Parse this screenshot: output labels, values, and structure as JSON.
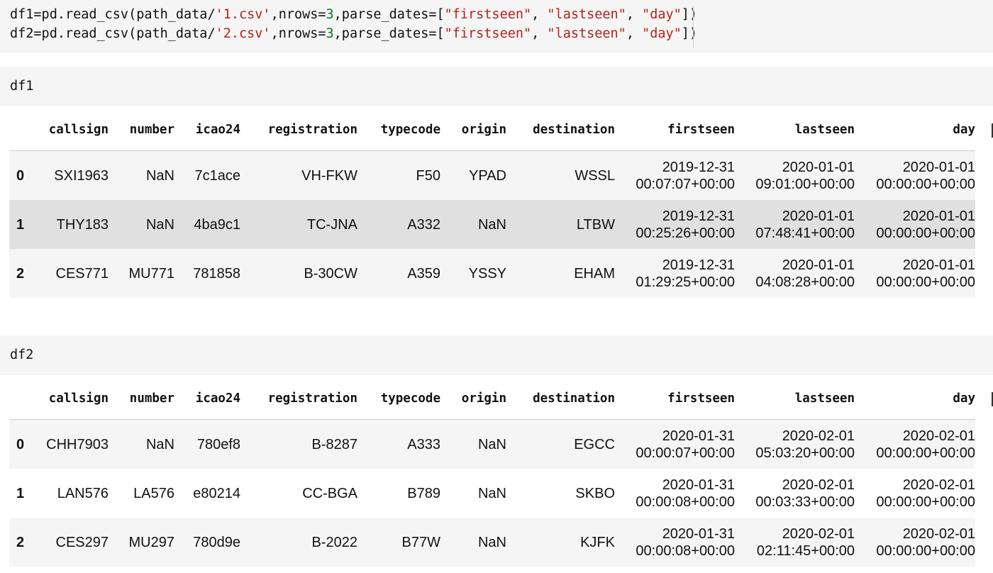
{
  "code": {
    "line1": {
      "a": "df1=pd.read_csv(path_data/",
      "b": "'1.csv'",
      "c": ",nrows=",
      "d": "3",
      "e": ",parse_dates=[",
      "f": "\"firstseen\"",
      "g": ", ",
      "h": "\"lastseen\"",
      "i": ", ",
      "j": "\"day\"",
      "k": "])"
    },
    "line2": {
      "a": "df2=pd.read_csv(path_data/",
      "b": "'2.csv'",
      "c": ",nrows=",
      "d": "3",
      "e": ",parse_dates=[",
      "f": "\"firstseen\"",
      "g": ", ",
      "h": "\"lastseen\"",
      "i": ", ",
      "j": "\"day\"",
      "k": "])"
    }
  },
  "cells": {
    "df1_input": "df1",
    "df2_input": "df2"
  },
  "columns": [
    "",
    "callsign",
    "number",
    "icao24",
    "registration",
    "typecode",
    "origin",
    "destination",
    "firstseen",
    "lastseen",
    "day"
  ],
  "df1": {
    "rows": [
      {
        "idx": "0",
        "callsign": "SXI1963",
        "number": "NaN",
        "icao24": "7c1ace",
        "registration": "VH-FKW",
        "typecode": "F50",
        "origin": "YPAD",
        "destination": "WSSL",
        "firstseen_date": "2019-12-31",
        "firstseen_time": "00:07:07+00:00",
        "lastseen_date": "2020-01-01",
        "lastseen_time": "09:01:00+00:00",
        "day_date": "2020-01-01",
        "day_time": "00:00:00+00:00"
      },
      {
        "idx": "1",
        "callsign": "THY183",
        "number": "NaN",
        "icao24": "4ba9c1",
        "registration": "TC-JNA",
        "typecode": "A332",
        "origin": "NaN",
        "destination": "LTBW",
        "firstseen_date": "2019-12-31",
        "firstseen_time": "00:25:26+00:00",
        "lastseen_date": "2020-01-01",
        "lastseen_time": "07:48:41+00:00",
        "day_date": "2020-01-01",
        "day_time": "00:00:00+00:00"
      },
      {
        "idx": "2",
        "callsign": "CES771",
        "number": "MU771",
        "icao24": "781858",
        "registration": "B-30CW",
        "typecode": "A359",
        "origin": "YSSY",
        "destination": "EHAM",
        "firstseen_date": "2019-12-31",
        "firstseen_time": "01:29:25+00:00",
        "lastseen_date": "2020-01-01",
        "lastseen_time": "04:08:28+00:00",
        "day_date": "2020-01-01",
        "day_time": "00:00:00+00:00"
      }
    ]
  },
  "df2": {
    "rows": [
      {
        "idx": "0",
        "callsign": "CHH7903",
        "number": "NaN",
        "icao24": "780ef8",
        "registration": "B-8287",
        "typecode": "A333",
        "origin": "NaN",
        "destination": "EGCC",
        "firstseen_date": "2020-01-31",
        "firstseen_time": "00:00:07+00:00",
        "lastseen_date": "2020-02-01",
        "lastseen_time": "05:03:20+00:00",
        "day_date": "2020-02-01",
        "day_time": "00:00:00+00:00"
      },
      {
        "idx": "1",
        "callsign": "LAN576",
        "number": "LA576",
        "icao24": "e80214",
        "registration": "CC-BGA",
        "typecode": "B789",
        "origin": "NaN",
        "destination": "SKBO",
        "firstseen_date": "2020-01-31",
        "firstseen_time": "00:00:08+00:00",
        "lastseen_date": "2020-02-01",
        "lastseen_time": "00:03:33+00:00",
        "day_date": "2020-02-01",
        "day_time": "00:00:00+00:00"
      },
      {
        "idx": "2",
        "callsign": "CES297",
        "number": "MU297",
        "icao24": "780d9e",
        "registration": "B-2022",
        "typecode": "B77W",
        "origin": "NaN",
        "destination": "KJFK",
        "firstseen_date": "2020-01-31",
        "firstseen_time": "00:00:08+00:00",
        "lastseen_date": "2020-02-01",
        "lastseen_time": "02:11:45+00:00",
        "day_date": "2020-02-01",
        "day_time": "00:00:00+00:00"
      }
    ]
  }
}
